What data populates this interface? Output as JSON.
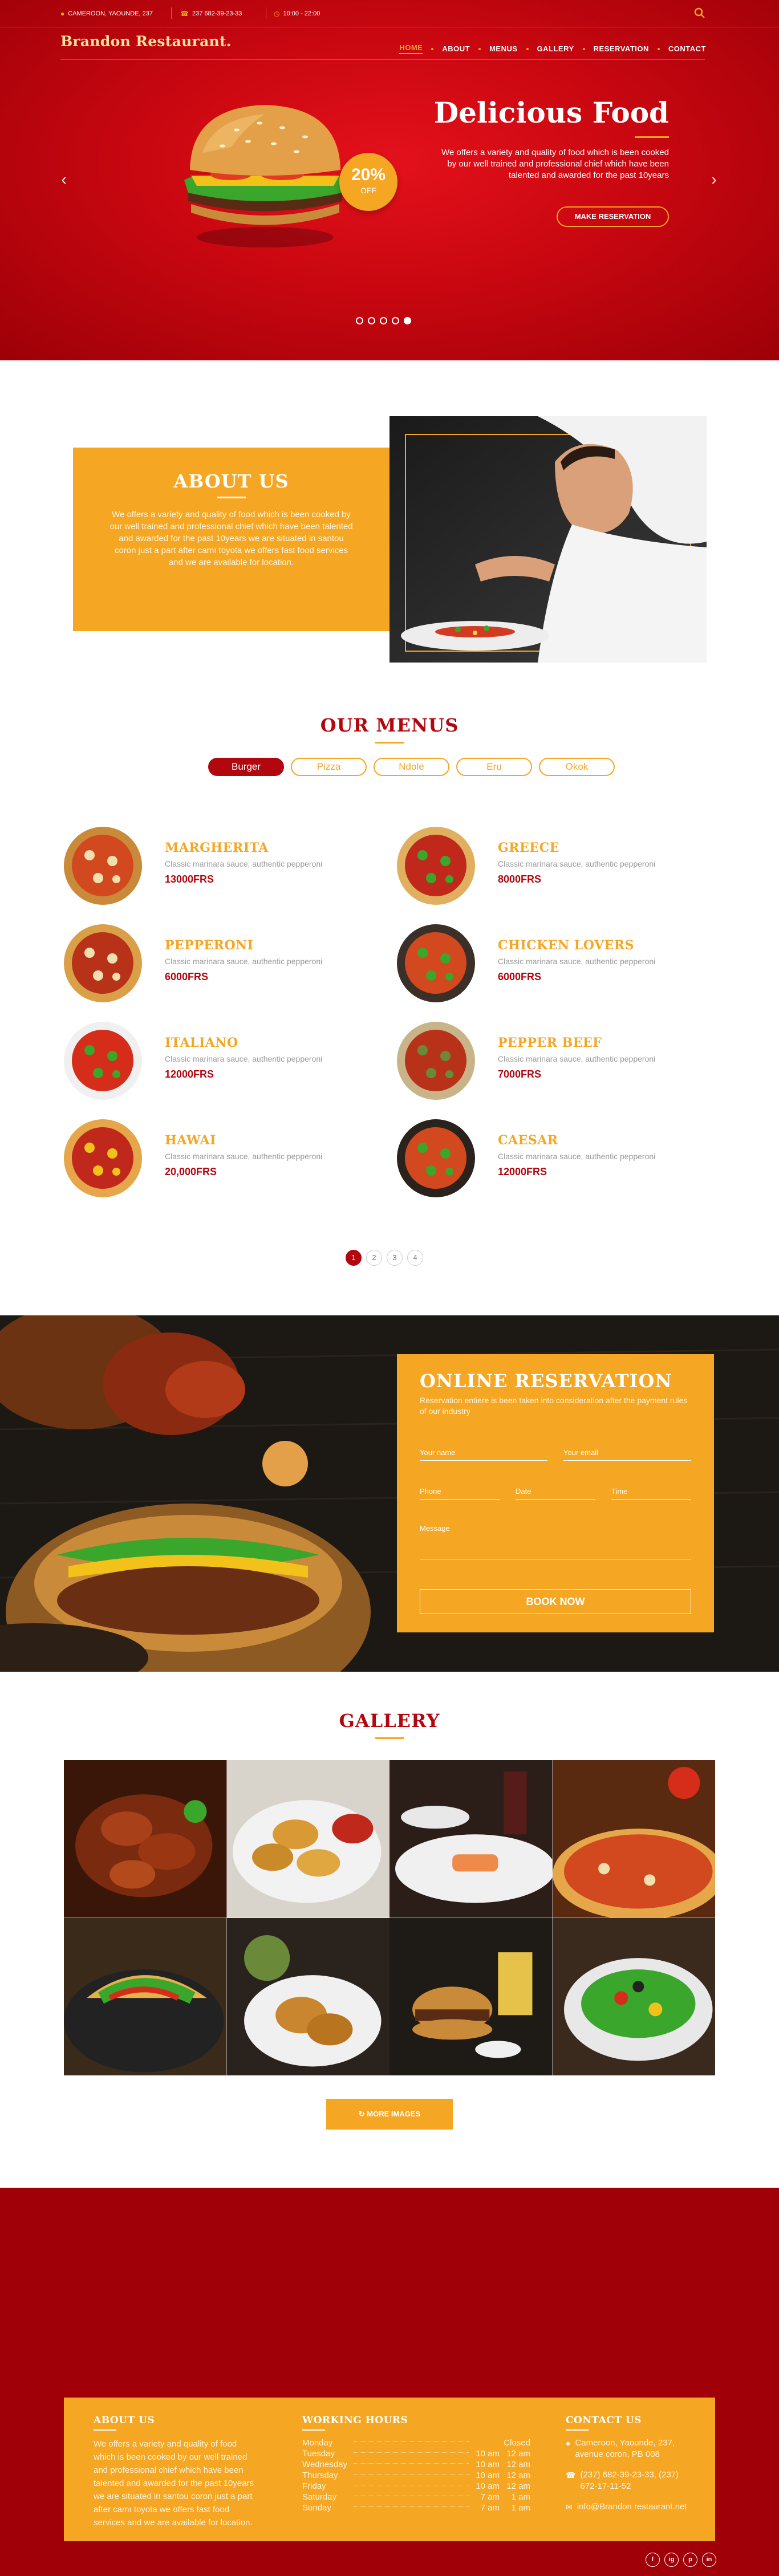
{
  "topbar": {
    "address": "CAMEROON, YAOUNDE, 237",
    "phone": "237 682-39-23-33",
    "hours": "10:00 - 22:00"
  },
  "brand": "Brandon Restaurant.",
  "nav": [
    "HOME",
    "ABOUT",
    "MENUS",
    "GALLERY",
    "RESERVATION",
    "CONTACT"
  ],
  "hero": {
    "title": "Delicious Food",
    "text": "We offers a variety and quality of food which is been cooked by our well trained and professional chief which have been talented and awarded for the past 10years",
    "button": "MAKE RESERVATION",
    "badge_pct": "20%",
    "badge_off": "OFF",
    "slide_count": 5,
    "active_slide": 5
  },
  "about": {
    "title": "ABOUT US",
    "text": "We offers a variety and quality of food which is been cooked by our well trained and professional chief which have been talented and awarded for the past 10years we are situated in santou coron just a part after camı toyota we offers fast food services and we are available for location."
  },
  "menus": {
    "title": "OUR MENUS",
    "tabs": [
      "Burger",
      "Pizza",
      "Ndole",
      "Eru",
      "Okok"
    ],
    "items": [
      {
        "name": "MARGHERITA",
        "desc": "Classic marinara sauce, authentic pepperoni",
        "price": "13000FRS"
      },
      {
        "name": "GREECE",
        "desc": "Classic marinara sauce, authentic pepperoni",
        "price": "8000FRS"
      },
      {
        "name": "PEPPERONI",
        "desc": "Classic marinara sauce, authentic pepperoni",
        "price": "6000FRS"
      },
      {
        "name": "CHICKEN LOVERS",
        "desc": "Classic marinara sauce, authentic pepperoni",
        "price": "6000FRS"
      },
      {
        "name": "ITALIANO",
        "desc": "Classic marinara sauce, authentic pepperoni",
        "price": "12000FRS"
      },
      {
        "name": "PEPPER BEEF",
        "desc": "Classic marinara sauce, authentic pepperoni",
        "price": "7000FRS"
      },
      {
        "name": "HAWAI",
        "desc": "Classic marinara sauce, authentic pepperoni",
        "price": "20,000FRS"
      },
      {
        "name": "CAESAR",
        "desc": "Classic marinara sauce, authentic pepperoni",
        "price": "12000FRS"
      }
    ],
    "pages": [
      "1",
      "2",
      "3",
      "4"
    ]
  },
  "reservation": {
    "title": "ONLINE RESERVATION",
    "subtitle": "Reservation entiere is been taken into consideration after the payment rules of our industry",
    "fields": {
      "name": "Your name",
      "email": "Your email",
      "phone": "Phone",
      "date": "Date",
      "time": "Time",
      "message": "Message"
    },
    "button": "BOOK NOW"
  },
  "gallery": {
    "title": "GALLERY",
    "button": "↻ MORE IMAGES"
  },
  "footer": {
    "about_title": "ABOUT US",
    "about_text": "We offers a variety and quality of food which is been cooked by our well trained and professional chief which have been talented and awarded for the past 10years we are situated in santou coron just a part after camı toyota we offers fast food services and we are available for location.",
    "hours_title": "WORKING HOURS",
    "hours": [
      {
        "day": "Monday",
        "open": "",
        "close": "Closed"
      },
      {
        "day": "Tuesday",
        "open": "10 am",
        "close": "12 am"
      },
      {
        "day": "Wednesday",
        "open": "10 am",
        "close": "12 am"
      },
      {
        "day": "Thursday",
        "open": "10 am",
        "close": "12 am"
      },
      {
        "day": "Friday",
        "open": "10 am",
        "close": "12 am"
      },
      {
        "day": "Saturday",
        "open": "7 am",
        "close": "1 am"
      },
      {
        "day": "Sunday",
        "open": "7 am",
        "close": "1 am"
      }
    ],
    "contact_title": "CONTACT US",
    "address": "Cameroon, Yaounde, 237, avenue coron, PB 008",
    "phone": "(237) 682-39-23-33, (237) 672-17-11-52",
    "email": "info@Brandon restaurant.net",
    "socials": [
      "f",
      "ig",
      "p",
      "in"
    ]
  },
  "colors": {
    "red": "#b2070f",
    "accent": "#f5a623"
  }
}
